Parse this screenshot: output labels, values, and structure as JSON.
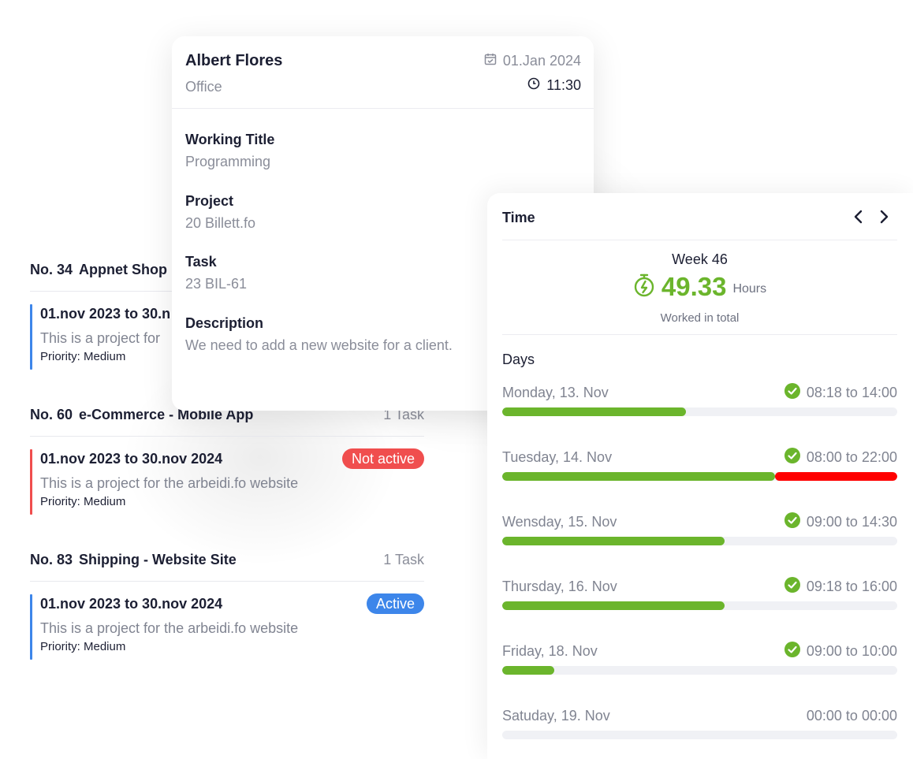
{
  "colors": {
    "accent_green": "#6bb52c",
    "overtime_red": "#ff0000",
    "badge_red": "#f04e4e",
    "badge_blue": "#3d86ea",
    "bar_blue": "#3d86ea",
    "bar_red": "#f04e4e"
  },
  "projects": [
    {
      "number": "No. 34",
      "name": "Appnet Shop",
      "task_count": "",
      "dates": "01.nov 2023 to 30.n",
      "badge": "",
      "description": "This is a project for",
      "priority": "Priority: Medium"
    },
    {
      "number": "No. 60",
      "name": "e-Commerce - Mobile App",
      "task_count": "1 Task",
      "dates": "01.nov 2023 to 30.nov 2024",
      "badge": "Not active",
      "description": "This is a project for the arbeidi.fo website",
      "priority": "Priority: Medium"
    },
    {
      "number": "No. 83",
      "name": "Shipping - Website Site",
      "task_count": "1 Task",
      "dates": "01.nov 2023 to 30.nov 2024",
      "badge": "Active",
      "description": "This is a project for the arbeidi.fo website",
      "priority": "Priority: Medium"
    }
  ],
  "detail": {
    "name": "Albert Flores",
    "place": "Office",
    "date": "01.Jan 2024",
    "date_icon": "calendar-icon",
    "time": "11:30",
    "time_icon": "clock-icon",
    "fields": [
      {
        "label": "Working Title",
        "value": "Programming"
      },
      {
        "label": "Project",
        "value": "20 Billett.fo"
      },
      {
        "label": "Task",
        "value": "23 BIL-61"
      },
      {
        "label": "Description",
        "value": "We need to add a new website for a client."
      }
    ]
  },
  "time_card": {
    "title": "Time",
    "prev_icon": "chevron-left-icon",
    "next_icon": "chevron-right-icon",
    "week": "Week 46",
    "hours": "49.33",
    "hours_unit": "Hours",
    "subtitle": "Worked in total",
    "hours_icon": "stopwatch-icon",
    "days_label": "Days",
    "days": [
      {
        "name": "Monday, 13. Nov",
        "range": "08:18 to 14:00",
        "checked": true,
        "normal": 0.466,
        "overtime": 0
      },
      {
        "name": "Tuesday, 14. Nov",
        "range": "08:00 to 22:00",
        "checked": true,
        "normal": 0.69,
        "overtime": 0.31
      },
      {
        "name": "Wensday, 15. Nov",
        "range": "09:00 to 14:30",
        "checked": true,
        "normal": 0.563,
        "overtime": 0
      },
      {
        "name": "Thursday, 16. Nov",
        "range": "09:18 to 16:00",
        "checked": true,
        "normal": 0.563,
        "overtime": 0
      },
      {
        "name": "Friday, 18. Nov",
        "range": "09:00 to 10:00",
        "checked": true,
        "normal": 0.131,
        "overtime": 0
      },
      {
        "name": "Satuday, 19. Nov",
        "range": "00:00 to 00:00",
        "checked": false,
        "normal": 0,
        "overtime": 0
      }
    ]
  }
}
